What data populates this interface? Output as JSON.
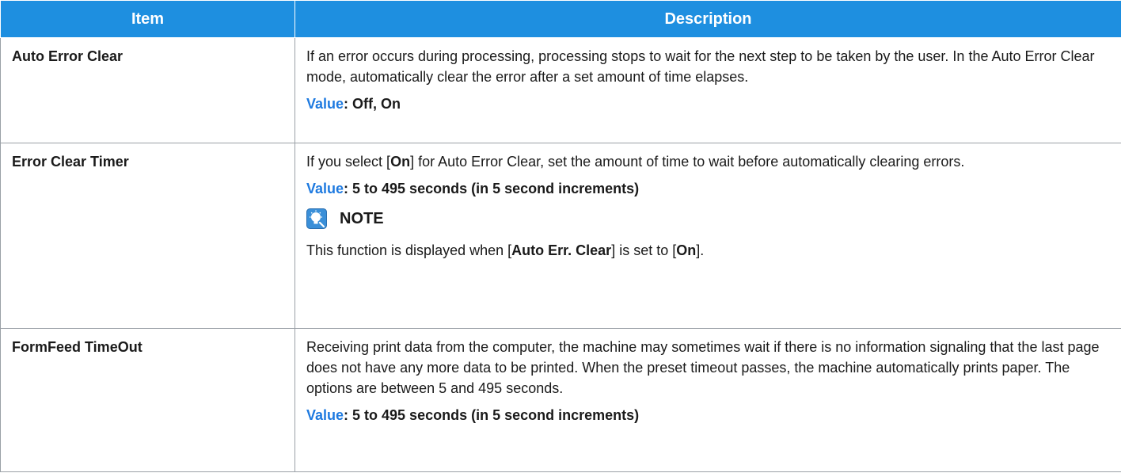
{
  "table": {
    "header": {
      "item": "Item",
      "description": "Description"
    },
    "rows": [
      {
        "item": "Auto Error Clear",
        "description": "If an error occurs during processing, processing stops to wait for the next step to be taken by the user. In the Auto Error Clear mode, automatically clear the error after a set amount of time elapses.",
        "value_label": "Value",
        "value_text": ": Off, On"
      },
      {
        "item": "Error Clear Timer",
        "desc_pre": "If you select [",
        "desc_bold": "On",
        "desc_post": "] for Auto Error Clear, set the amount of time to wait before automatically clearing errors.",
        "value_label": "Value",
        "value_text": ": 5 to 495 seconds (in 5 second increments)",
        "note_label": "NOTE",
        "note_pre": "This function is displayed when [",
        "note_bold1": "Auto Err. Clear",
        "note_mid": "] is set to [",
        "note_bold2": "On",
        "note_post": "]."
      },
      {
        "item": "FormFeed TimeOut",
        "description": "Receiving print data from the computer, the machine may sometimes wait if there is no information signaling that the last page does not have any more data to be printed. When the preset timeout passes, the machine automatically prints paper. The options are between 5 and 495 seconds.",
        "value_label": "Value",
        "value_text": ": 5 to 495 seconds (in 5 second increments)"
      }
    ]
  },
  "colors": {
    "header_bg": "#1e8fe0",
    "value_label": "#1e7ae0",
    "border": "#9aa0a6"
  },
  "icons": {
    "note": "lightbulb-note-icon"
  }
}
